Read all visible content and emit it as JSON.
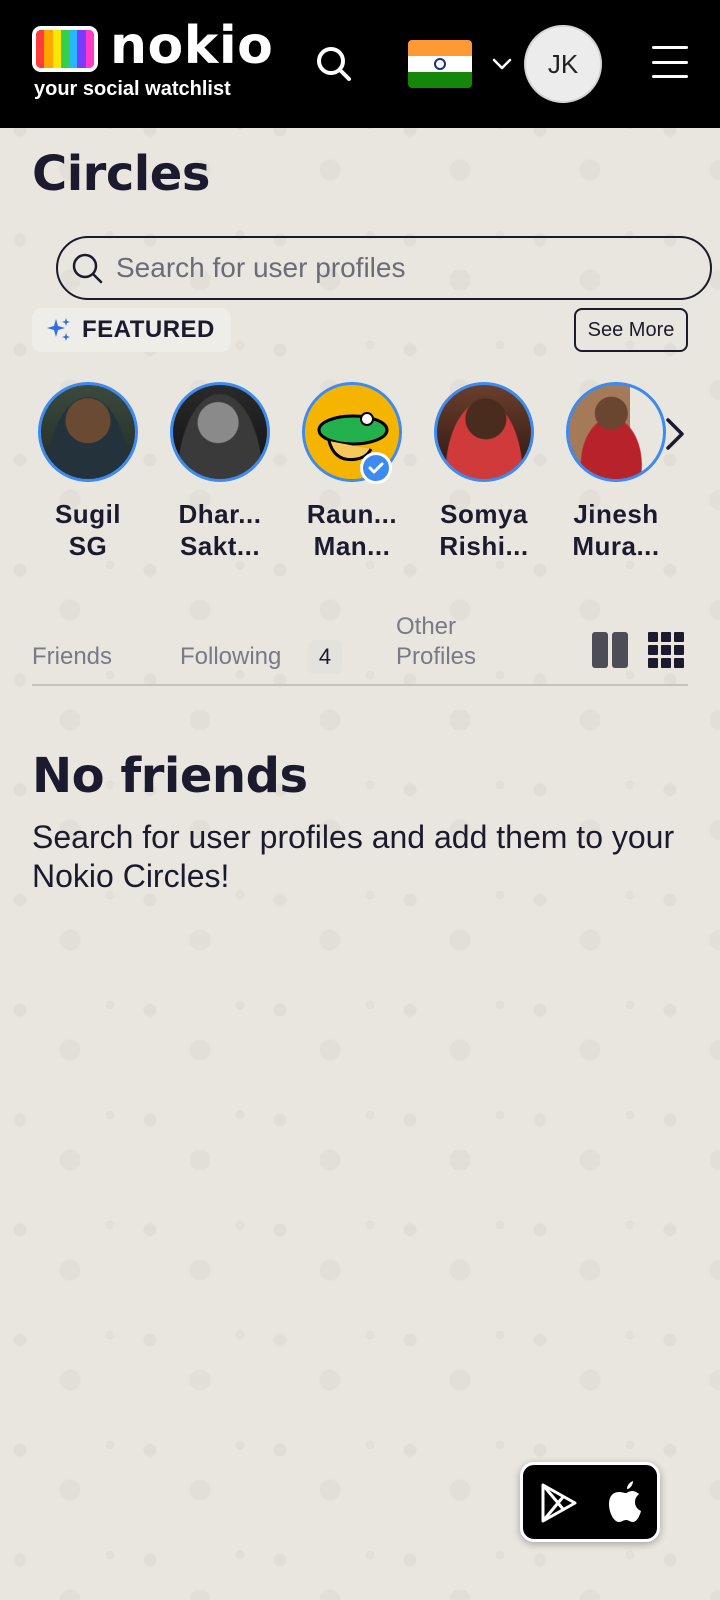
{
  "header": {
    "brand_name": "nokio",
    "tagline": "your social watchlist",
    "avatar_initials": "JK",
    "icons": [
      "search-icon",
      "india-flag-icon",
      "chevron-down-icon",
      "menu-icon"
    ]
  },
  "page": {
    "title": "Circles"
  },
  "search": {
    "placeholder": "Search for user profiles",
    "value": ""
  },
  "featured": {
    "label": "FEATURED",
    "see_more_label": "See More",
    "profiles": [
      {
        "name_line1": "Sugil",
        "name_line2": "SG",
        "verified": false
      },
      {
        "name_line1": "Dhar...",
        "name_line2": "Sakt...",
        "verified": false
      },
      {
        "name_line1": "Raun...",
        "name_line2": "Man...",
        "verified": true
      },
      {
        "name_line1": "Somya",
        "name_line2": "Rishi...",
        "verified": false
      },
      {
        "name_line1": "Jinesh",
        "name_line2": "Mura...",
        "verified": false
      }
    ]
  },
  "tabs": {
    "friends": "Friends",
    "following": "Following",
    "following_count": "4",
    "other_line1": "Other",
    "other_line2": "Profiles"
  },
  "empty_state": {
    "title": "No friends",
    "description": "Search for user profiles and add them to your Nokio Circles!"
  },
  "colors": {
    "header_bg": "#000000",
    "page_bg": "#e9e6df",
    "text_primary": "#1b1a2e",
    "ring_accent": "#3d8bf0"
  }
}
